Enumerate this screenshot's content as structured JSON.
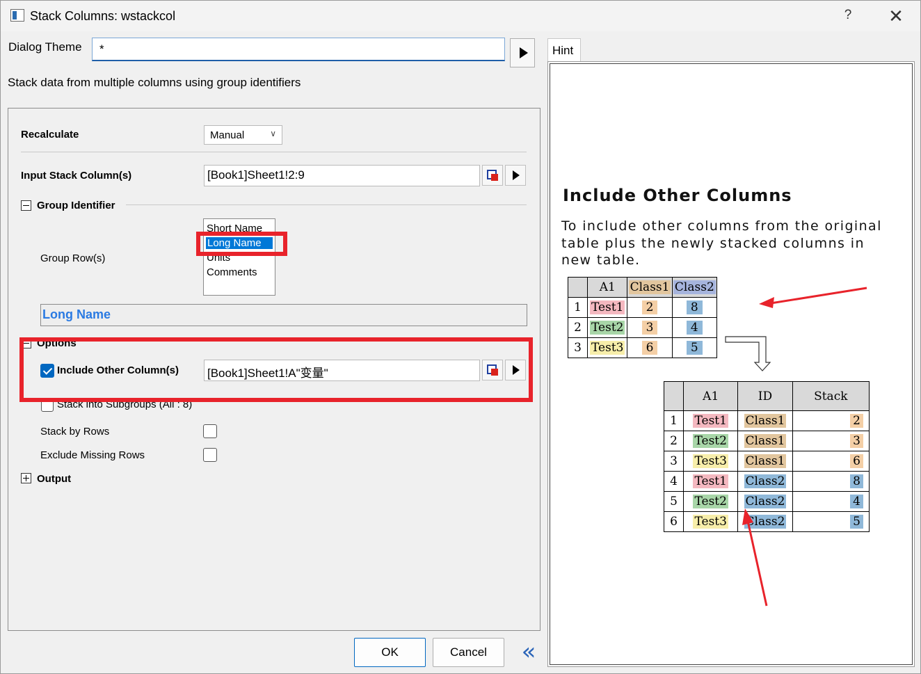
{
  "window": {
    "title": "Stack Columns: wstackcol",
    "help_label": "?",
    "close_label": "✕"
  },
  "dialog_theme": {
    "label": "Dialog Theme",
    "value": "*"
  },
  "description": "Stack data from multiple columns using group identifiers",
  "form": {
    "recalculate": {
      "label": "Recalculate",
      "value": "Manual"
    },
    "input_stack": {
      "label": "Input Stack Column(s)",
      "value": "[Book1]Sheet1!2:9"
    },
    "group_identifier": {
      "label": "Group Identifier",
      "group_rows_label": "Group Row(s)",
      "options": [
        "Short Name",
        "Long Name",
        "Units",
        "Comments"
      ],
      "selected": "Long Name"
    },
    "long_name_display": "Long Name",
    "options_label": "Options",
    "include_other": {
      "label": "Include Other Column(s)",
      "value": "[Book1]Sheet1!A\"变量\"",
      "checked": true
    },
    "stack_subgroups": {
      "label": "Stack into Subgroups (All : 8)",
      "checked": false
    },
    "stack_by_rows": {
      "label": "Stack by Rows",
      "checked": false
    },
    "exclude_missing": {
      "label": "Exclude Missing Rows",
      "checked": false
    },
    "output_label": "Output"
  },
  "buttons": {
    "ok": "OK",
    "cancel": "Cancel",
    "collapse": "«"
  },
  "hint": {
    "tab_label": "Hint",
    "title": "Include Other Columns",
    "description": "To include other columns from the original table plus the newly stacked columns in new table.",
    "table1": {
      "headers": [
        "",
        "A1",
        "Class1",
        "Class2"
      ],
      "rows": [
        [
          "1",
          "Test1",
          "2",
          "8"
        ],
        [
          "2",
          "Test2",
          "3",
          "4"
        ],
        [
          "3",
          "Test3",
          "6",
          "5"
        ]
      ]
    },
    "table2": {
      "headers": [
        "",
        "A1",
        "ID",
        "Stack"
      ],
      "rows": [
        [
          "1",
          "Test1",
          "Class1",
          "2"
        ],
        [
          "2",
          "Test2",
          "Class1",
          "3"
        ],
        [
          "3",
          "Test3",
          "Class1",
          "6"
        ],
        [
          "4",
          "Test1",
          "Class2",
          "8"
        ],
        [
          "5",
          "Test2",
          "Class2",
          "4"
        ],
        [
          "6",
          "Test3",
          "Class2",
          "5"
        ]
      ]
    }
  },
  "colors": {
    "highlight_box": "#e8232b",
    "selection": "#0078d7",
    "link_blue": "#2a7ae2"
  }
}
